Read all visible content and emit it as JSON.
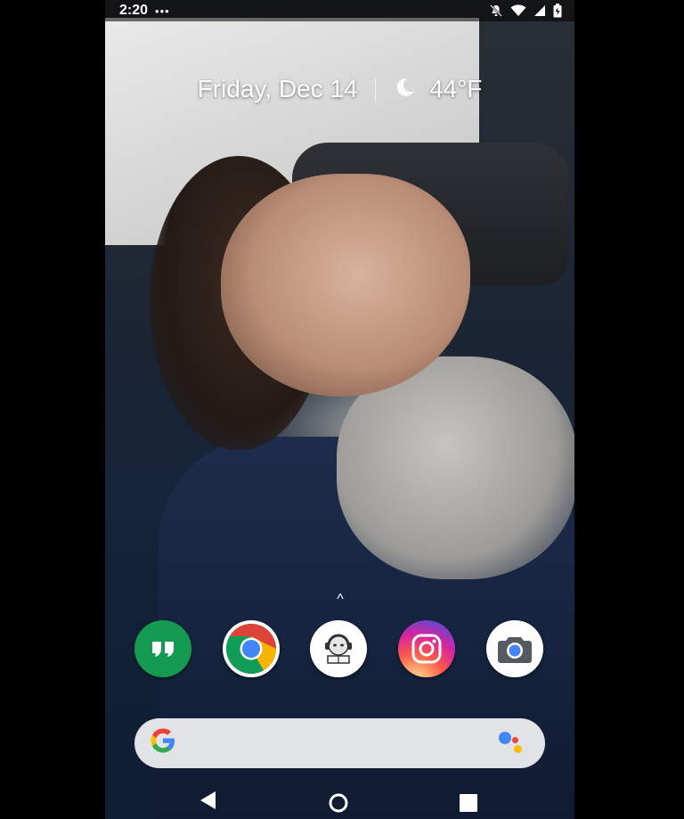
{
  "status_bar": {
    "time": "2:20",
    "dots": "•••"
  },
  "widget": {
    "date": "Friday, Dec 14",
    "temperature": "44°F"
  },
  "dock": {
    "up_arrow": "^"
  },
  "search": {
    "logo": "G"
  },
  "colors": {
    "hangouts": "#159a52",
    "chrome_red": "#db4437",
    "chrome_yellow": "#f4b400",
    "chrome_green": "#0f9d58",
    "chrome_blue": "#4285f4",
    "search_bg": "#ffffff"
  },
  "icons": {
    "status": [
      "notifications-off-icon",
      "wifi-icon",
      "signal-icon",
      "battery-icon"
    ],
    "dock": [
      "hangouts-icon",
      "chrome-icon",
      "custom-app-icon",
      "instagram-icon",
      "camera-icon"
    ],
    "nav": [
      "back-icon",
      "home-icon",
      "recents-icon"
    ]
  }
}
